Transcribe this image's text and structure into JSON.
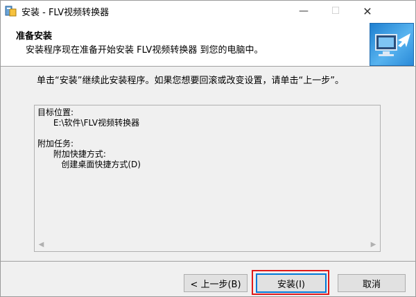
{
  "window": {
    "title": "安装 - FLV视频转换器",
    "icon": "installer-icon",
    "controls": {
      "minimize": "—",
      "maximize": "☐",
      "close": "✕"
    }
  },
  "header": {
    "title": "准备安装",
    "subtitle": "安装程序现在准备开始安装 FLV视频转换器 到您的电脑中。",
    "image": "computer-install-graphic"
  },
  "body": {
    "instruction": "单击“安装”继续此安装程序。如果您想要回滚或改变设置，请单击“上一步”。",
    "memo": {
      "text": "目标位置:\n      E:\\软件\\FLV视频转换器\n\n附加任务:\n      附加快捷方式:\n         创建桌面快捷方式(D)"
    }
  },
  "buttons": {
    "back": "< 上一步(B)",
    "install": "安装(I)",
    "cancel": "取消"
  },
  "colors": {
    "highlight": "#e01919",
    "focus_border": "#0078d7"
  }
}
